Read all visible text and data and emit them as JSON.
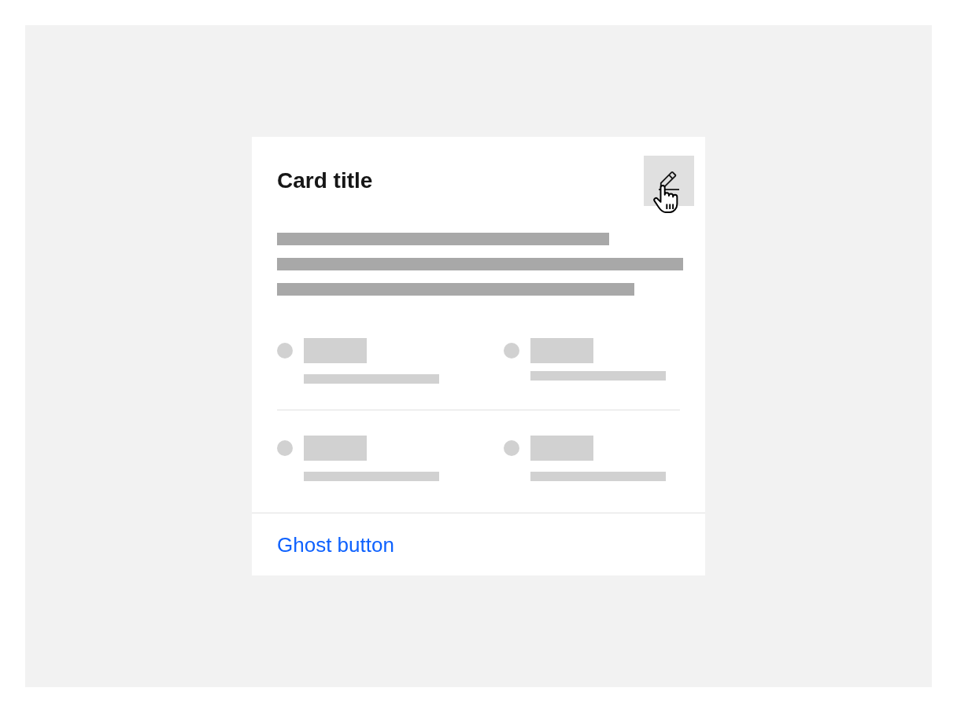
{
  "card": {
    "title": "Card title",
    "edit_button": {
      "hovered": true
    },
    "footer": {
      "actions": [
        {
          "label": "Ghost button",
          "kind": "ghost"
        }
      ]
    }
  }
}
